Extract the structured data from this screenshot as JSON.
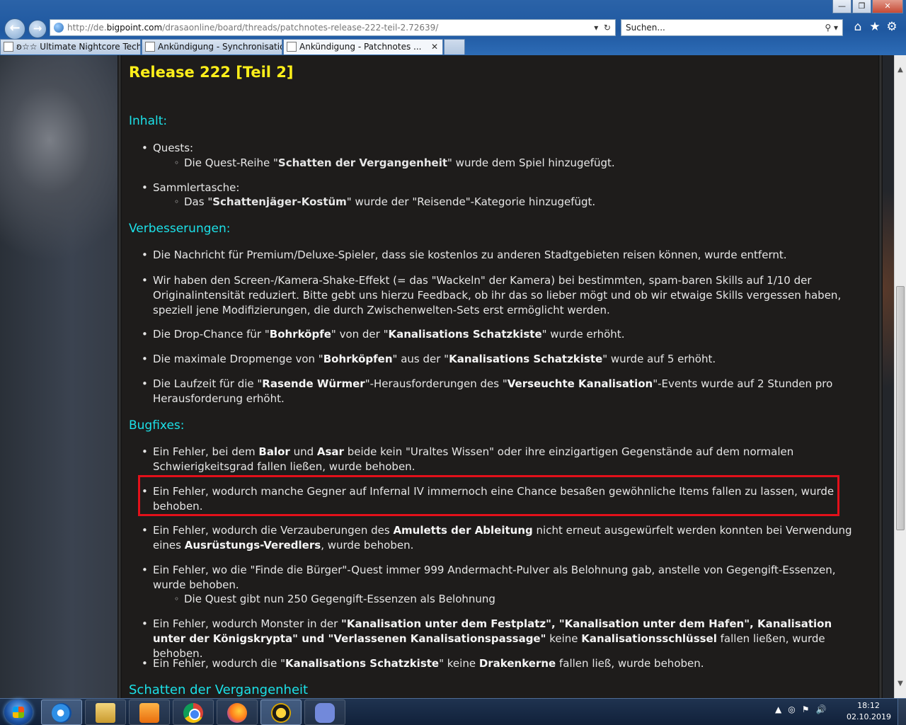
{
  "browser": {
    "url_prefix": "http://de.",
    "url_host": "bigpoint.com",
    "url_path": "/drasaonline/board/threads/patchnotes-release-222-teil-2.72639/",
    "search_placeholder": "Suchen...",
    "window_buttons": {
      "minimize": "—",
      "maximize": "❐",
      "close": "✕"
    },
    "tabs": [
      {
        "label": "ʚ☆☆ Ultimate Nightcore Tech..."
      },
      {
        "label": "Ankündigung - Synchronisatio..."
      },
      {
        "label": "Ankündigung - Patchnotes ..."
      }
    ],
    "tab_close": "✕",
    "icons": {
      "back": "back-arrow-icon",
      "forward": "forward-arrow-icon",
      "home": "home-icon",
      "favorites": "star-icon",
      "settings": "gear-icon"
    }
  },
  "page": {
    "title": "Release 222 [Teil 2]",
    "sections": {
      "inhalt": "Inhalt:",
      "verbesserungen": "Verbesserungen:",
      "bugfixes": "Bugfixes:",
      "next": "Schatten der Vergangenheit"
    },
    "inhalt": {
      "quests": "Quests:",
      "quests_sub": {
        "pre": "Die Quest-Reihe \"",
        "b1": "Schatten der Vergangenheit",
        "post": "\" wurde dem Spiel hinzugefügt."
      },
      "sammler": "Sammlertasche:",
      "sammler_sub": {
        "pre": "Das \"",
        "b1": "Schattenjäger-Kostüm",
        "post": "\" wurde der \"Reisende\"-Kategorie hinzugefügt."
      }
    },
    "verbesserungen": {
      "v1": "Die Nachricht für Premium/Deluxe-Spieler, dass sie kostenlos zu anderen Stadtgebieten reisen können, wurde entfernt.",
      "v2": "Wir haben den Screen-/Kamera-Shake-Effekt (= das \"Wackeln\" der Kamera) bei bestimmten, spam-baren Skills auf 1/10 der Originalintensität reduziert. Bitte gebt uns hierzu Feedback, ob ihr das so lieber mögt und ob wir etwaige Skills vergessen haben, speziell jene Modifizierungen, die durch Zwischenwelten-Sets erst ermöglicht werden.",
      "v3": {
        "a": "Die Drop-Chance für \"",
        "b": "Bohrköpfe",
        "c": "\" von der \"",
        "d": "Kanalisations Schatzkiste",
        "e": "\" wurde erhöht."
      },
      "v4": {
        "a": "Die maximale Dropmenge von \"",
        "b": "Bohrköpfen",
        "c": "\" aus der \"",
        "d": "Kanalisations Schatzkiste",
        "e": "\" wurde auf 5 erhöht."
      },
      "v5": {
        "a": "Die Laufzeit für die \"",
        "b": "Rasende Würmer",
        "c": "\"-Herausforderungen des \"",
        "d": "Verseuchte Kanalisation",
        "e": "\"-Events wurde auf 2 Stunden pro Herausforderung erhöht."
      }
    },
    "bugfixes": {
      "b1": {
        "a": "Ein Fehler, bei dem ",
        "b": "Balor",
        "c": " und ",
        "d": "Asar",
        "e": " beide kein \"Uraltes Wissen\" oder ihre einzigartigen Gegenstände auf dem normalen Schwierigkeitsgrad fallen ließen, wurde behoben."
      },
      "b2": "Ein Fehler, wodurch manche Gegner auf Infernal IV immernoch eine Chance besaßen gewöhnliche Items fallen zu lassen, wurde behoben.",
      "b3": {
        "a": "Ein Fehler, wodurch die Verzauberungen des ",
        "b": "Amuletts der Ableitung",
        "c": " nicht erneut ausgewürfelt werden konnten bei Verwendung eines ",
        "d": "Ausrüstungs-Veredlers",
        "e": ", wurde behoben."
      },
      "b4": "Ein Fehler, wo die \"Finde die Bürger\"-Quest immer 999 Andermacht-Pulver als Belohnung gab, anstelle von Gegengift-Essenzen, wurde behoben.",
      "b4_sub": "Die Quest gibt nun 250 Gegengift-Essenzen als Belohnung",
      "b5": {
        "a": "Ein Fehler, wodurch Monster in der ",
        "b": "\"Kanalisation unter dem Festplatz\", \"Kanalisation unter dem Hafen\", Kanalisation unter der Königskrypta\" und \"Verlassenen Kanalisationspassage\"",
        "c": " keine ",
        "d": "Kanalisationsschlüssel",
        "e": " fallen ließen, wurde behoben."
      },
      "b6": {
        "a": "Ein Fehler, wodurch die \"",
        "b": "Kanalisations Schatzkiste",
        "c": "\" keine ",
        "d": "Drakenkerne",
        "e": " fallen ließ, wurde behoben."
      }
    },
    "colors": {
      "title": "#ffef1a",
      "section": "#1ce1e8",
      "highlight_border": "#e3101a"
    }
  },
  "taskbar": {
    "time": "18:12",
    "date": "02.10.2019",
    "tray_icons": [
      "arrow-up-icon",
      "network-icon",
      "flag-icon",
      "volume-icon"
    ]
  }
}
